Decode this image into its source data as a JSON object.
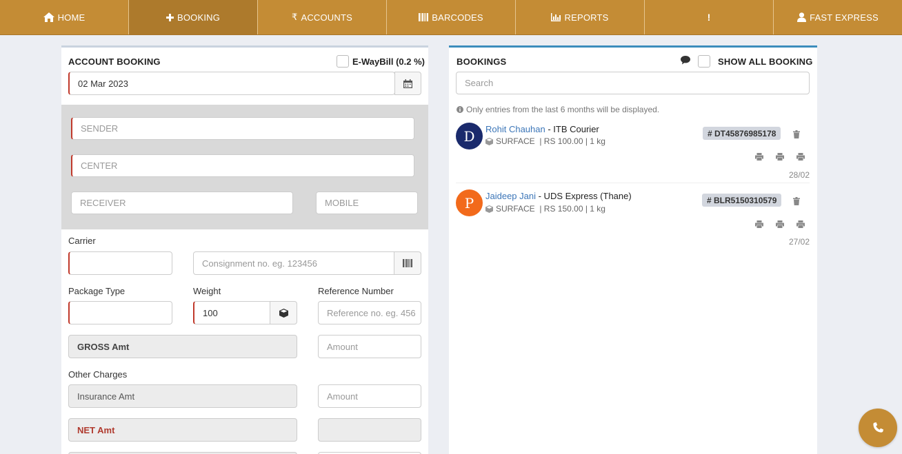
{
  "nav": {
    "home": "HOME",
    "booking": "BOOKING",
    "accounts": "ACCOUNTS",
    "barcodes": "BARCODES",
    "reports": "REPORTS",
    "alert": "!",
    "user": "FAST EXPRESS"
  },
  "account_booking": {
    "title": "ACCOUNT BOOKING",
    "eway_label": "E-WayBill (0.2 %)",
    "date": "02 Mar 2023",
    "sender_placeholder": "SENDER",
    "center_placeholder": "CENTER",
    "receiver_placeholder": "RECEIVER",
    "mobile_placeholder": "MOBILE",
    "carrier_label": "Carrier",
    "consignment_placeholder": "Consignment no. eg. 123456",
    "package_type_label": "Package Type",
    "weight_label": "Weight",
    "weight_value": "100",
    "reference_label": "Reference Number",
    "reference_placeholder": "Reference no. eg. 456",
    "gross_label": "GROSS Amt",
    "amount_placeholder": "Amount",
    "other_charges_label": "Other Charges",
    "insurance_label": "Insurance Amt",
    "net_label": "NET Amt"
  },
  "bookings": {
    "title": "BOOKINGS",
    "show_all_label": "SHOW ALL BOOKING",
    "search_placeholder": "Search",
    "note": "Only entries from the last 6 months will be displayed.",
    "items": [
      {
        "initial": "D",
        "avatar_color": "#1a2a6c",
        "name": "Rohit Chauhan",
        "carrier": " - ITB Courier",
        "meta": "SURFACE  | RS 100.00 | 1 kg",
        "id": "# DT45876985178",
        "date": "28/02"
      },
      {
        "initial": "P",
        "avatar_color": "#f26a1b",
        "name": "Jaideep Jani",
        "carrier": " - UDS Express (Thane)",
        "meta": "SURFACE  | RS 150.00 | 1 kg",
        "id": "# BLR5150310579",
        "date": "27/02"
      }
    ]
  },
  "colors": {
    "nav": "#c48c35",
    "nav_active": "#ad7a2c",
    "required": "#c0392b",
    "link": "#3c76b8"
  }
}
